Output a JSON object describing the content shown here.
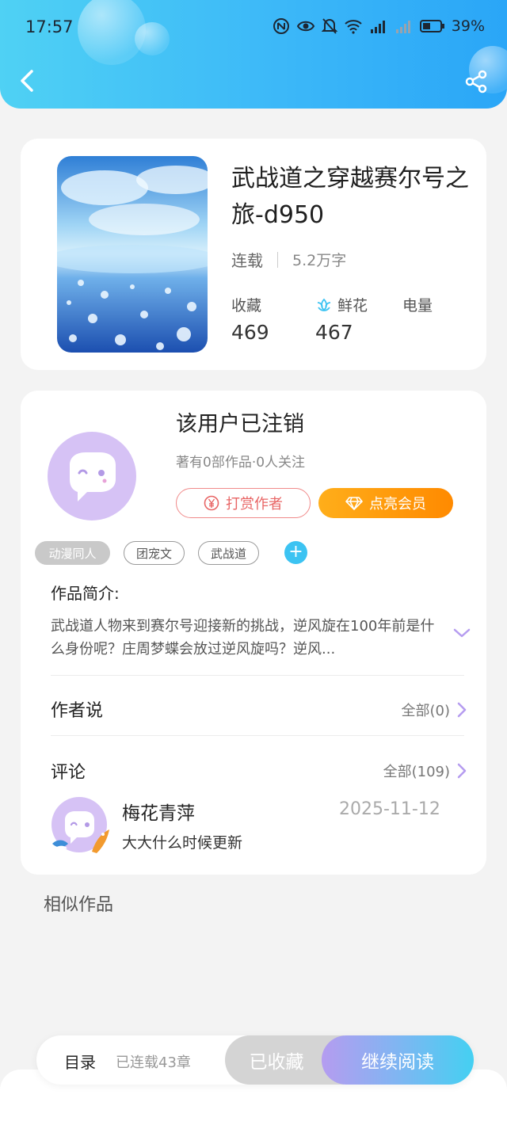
{
  "status_bar": {
    "time": "17:57",
    "battery": "39%"
  },
  "book": {
    "title": "武战道之穿越赛尔号之旅-d950",
    "status": "连载",
    "word_count": "5.2万字",
    "stats": [
      {
        "label": "收藏",
        "value": "469"
      },
      {
        "label": "鲜花",
        "value": "467"
      },
      {
        "label": "电量",
        "value": ""
      }
    ]
  },
  "author": {
    "name": "该用户已注销",
    "info": "著有0部作品·0人关注",
    "tip_button": "打赏作者",
    "vip_button": "点亮会员",
    "tags": [
      "动漫同人",
      "团宠文",
      "武战道"
    ]
  },
  "synopsis": {
    "heading": "作品简介:",
    "text": "武战道人物来到赛尔号迎接新的挑战，逆风旋在100年前是什么身份呢？庄周梦蝶会放过逆风旋吗？逆风..."
  },
  "author_says": {
    "heading": "作者说",
    "link": "全部(0)"
  },
  "comments": {
    "heading": "评论",
    "link": "全部(109)",
    "items": [
      {
        "user": "梅花青萍",
        "date": "2025-11-12",
        "text": "大大什么时候更新"
      }
    ]
  },
  "similar": {
    "heading": "相似作品"
  },
  "bottom_bar": {
    "toc_label": "目录",
    "serial_label": "已连载43章",
    "collected_label": "已收藏",
    "read_label": "继续阅读"
  },
  "colors": {
    "header_start": "#4fd1f4",
    "header_end": "#2aa6f7",
    "vip_orange": "#ff8a00",
    "tip_red": "#e86666",
    "tag_blue": "#3cc3f2",
    "avatar_purple": "#d6c2f5"
  },
  "icons": [
    "back-icon",
    "share-icon",
    "flower-icon",
    "yen-icon",
    "diamond-icon",
    "plus-icon",
    "chevron-down-icon",
    "chevron-right-icon"
  ]
}
